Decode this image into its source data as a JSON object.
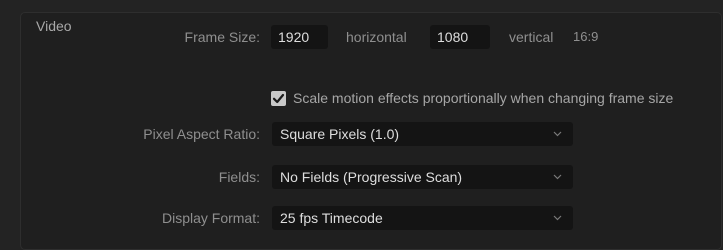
{
  "section": {
    "title": "Video"
  },
  "frame_size": {
    "label": "Frame Size:",
    "width_value": "1920",
    "width_unit": "horizontal",
    "height_value": "1080",
    "height_unit": "vertical",
    "aspect": "16:9"
  },
  "scale_option": {
    "checked": true,
    "label": "Scale motion effects proportionally when changing frame size"
  },
  "pixel_aspect": {
    "label": "Pixel Aspect Ratio:",
    "selected": "Square Pixels (1.0)"
  },
  "fields": {
    "label": "Fields:",
    "selected": "No Fields (Progressive Scan)"
  },
  "display_format": {
    "label": "Display Format:",
    "selected": "25 fps Timecode"
  },
  "icons": {
    "checkbox": "checkmark-icon",
    "dropdown": "chevron-down-icon"
  }
}
